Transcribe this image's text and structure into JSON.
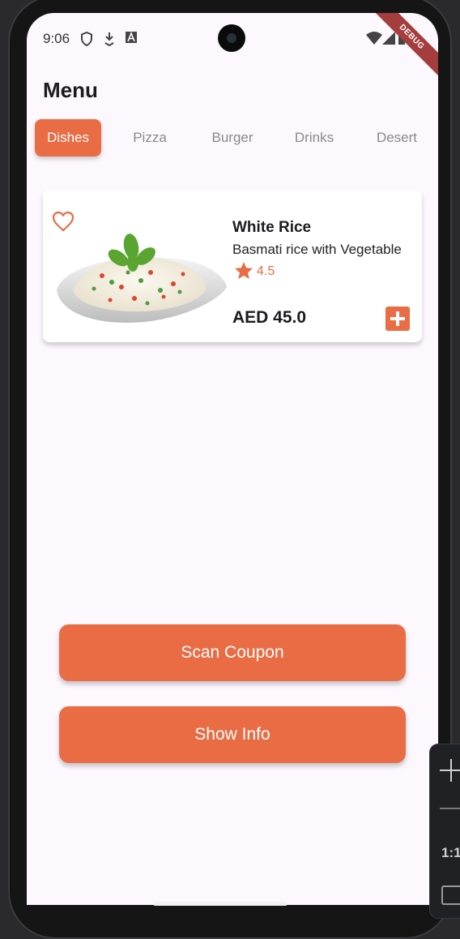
{
  "status_bar": {
    "time": "9:06",
    "left_icons": [
      "shield-icon",
      "download-icon",
      "a-icon"
    ],
    "right_icons": [
      "wifi-icon",
      "signal-icon",
      "battery-icon"
    ]
  },
  "debug_banner": "DEBUG",
  "header": {
    "title": "Menu"
  },
  "tabs": [
    {
      "label": "Dishes",
      "active": true
    },
    {
      "label": "Pizza",
      "active": false
    },
    {
      "label": "Burger",
      "active": false
    },
    {
      "label": "Drinks",
      "active": false
    },
    {
      "label": "Desert",
      "active": false
    }
  ],
  "dish_card": {
    "name": "White Rice",
    "description": "Basmati rice with Vegetable",
    "rating": "4.5",
    "price": "AED 45.0",
    "favorite_icon": "heart-outline-icon",
    "add_icon": "plus-icon"
  },
  "buttons": {
    "scan_coupon": "Scan Coupon",
    "show_info": "Show Info"
  },
  "emulator_toolbar": {
    "zoom_in_icon": "plus-icon",
    "zoom_out_icon": "minus-icon",
    "ratio_label": "1:1",
    "fit_icon": "fit-screen-icon"
  },
  "colors": {
    "accent": "#e96c45",
    "background": "#fdf7fe",
    "card": "#ffffff",
    "debug_ribbon": "#a43e3e"
  }
}
